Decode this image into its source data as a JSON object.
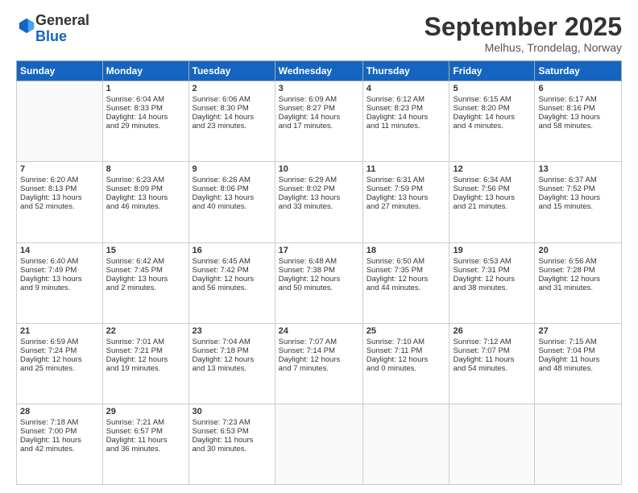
{
  "logo": {
    "general": "General",
    "blue": "Blue"
  },
  "title": "September 2025",
  "location": "Melhus, Trondelag, Norway",
  "days_header": [
    "Sunday",
    "Monday",
    "Tuesday",
    "Wednesday",
    "Thursday",
    "Friday",
    "Saturday"
  ],
  "weeks": [
    [
      {
        "day": "",
        "info": ""
      },
      {
        "day": "1",
        "info": "Sunrise: 6:04 AM\nSunset: 8:33 PM\nDaylight: 14 hours\nand 29 minutes."
      },
      {
        "day": "2",
        "info": "Sunrise: 6:06 AM\nSunset: 8:30 PM\nDaylight: 14 hours\nand 23 minutes."
      },
      {
        "day": "3",
        "info": "Sunrise: 6:09 AM\nSunset: 8:27 PM\nDaylight: 14 hours\nand 17 minutes."
      },
      {
        "day": "4",
        "info": "Sunrise: 6:12 AM\nSunset: 8:23 PM\nDaylight: 14 hours\nand 11 minutes."
      },
      {
        "day": "5",
        "info": "Sunrise: 6:15 AM\nSunset: 8:20 PM\nDaylight: 14 hours\nand 4 minutes."
      },
      {
        "day": "6",
        "info": "Sunrise: 6:17 AM\nSunset: 8:16 PM\nDaylight: 13 hours\nand 58 minutes."
      }
    ],
    [
      {
        "day": "7",
        "info": "Sunrise: 6:20 AM\nSunset: 8:13 PM\nDaylight: 13 hours\nand 52 minutes."
      },
      {
        "day": "8",
        "info": "Sunrise: 6:23 AM\nSunset: 8:09 PM\nDaylight: 13 hours\nand 46 minutes."
      },
      {
        "day": "9",
        "info": "Sunrise: 6:26 AM\nSunset: 8:06 PM\nDaylight: 13 hours\nand 40 minutes."
      },
      {
        "day": "10",
        "info": "Sunrise: 6:29 AM\nSunset: 8:02 PM\nDaylight: 13 hours\nand 33 minutes."
      },
      {
        "day": "11",
        "info": "Sunrise: 6:31 AM\nSunset: 7:59 PM\nDaylight: 13 hours\nand 27 minutes."
      },
      {
        "day": "12",
        "info": "Sunrise: 6:34 AM\nSunset: 7:56 PM\nDaylight: 13 hours\nand 21 minutes."
      },
      {
        "day": "13",
        "info": "Sunrise: 6:37 AM\nSunset: 7:52 PM\nDaylight: 13 hours\nand 15 minutes."
      }
    ],
    [
      {
        "day": "14",
        "info": "Sunrise: 6:40 AM\nSunset: 7:49 PM\nDaylight: 13 hours\nand 9 minutes."
      },
      {
        "day": "15",
        "info": "Sunrise: 6:42 AM\nSunset: 7:45 PM\nDaylight: 13 hours\nand 2 minutes."
      },
      {
        "day": "16",
        "info": "Sunrise: 6:45 AM\nSunset: 7:42 PM\nDaylight: 12 hours\nand 56 minutes."
      },
      {
        "day": "17",
        "info": "Sunrise: 6:48 AM\nSunset: 7:38 PM\nDaylight: 12 hours\nand 50 minutes."
      },
      {
        "day": "18",
        "info": "Sunrise: 6:50 AM\nSunset: 7:35 PM\nDaylight: 12 hours\nand 44 minutes."
      },
      {
        "day": "19",
        "info": "Sunrise: 6:53 AM\nSunset: 7:31 PM\nDaylight: 12 hours\nand 38 minutes."
      },
      {
        "day": "20",
        "info": "Sunrise: 6:56 AM\nSunset: 7:28 PM\nDaylight: 12 hours\nand 31 minutes."
      }
    ],
    [
      {
        "day": "21",
        "info": "Sunrise: 6:59 AM\nSunset: 7:24 PM\nDaylight: 12 hours\nand 25 minutes."
      },
      {
        "day": "22",
        "info": "Sunrise: 7:01 AM\nSunset: 7:21 PM\nDaylight: 12 hours\nand 19 minutes."
      },
      {
        "day": "23",
        "info": "Sunrise: 7:04 AM\nSunset: 7:18 PM\nDaylight: 12 hours\nand 13 minutes."
      },
      {
        "day": "24",
        "info": "Sunrise: 7:07 AM\nSunset: 7:14 PM\nDaylight: 12 hours\nand 7 minutes."
      },
      {
        "day": "25",
        "info": "Sunrise: 7:10 AM\nSunset: 7:11 PM\nDaylight: 12 hours\nand 0 minutes."
      },
      {
        "day": "26",
        "info": "Sunrise: 7:12 AM\nSunset: 7:07 PM\nDaylight: 11 hours\nand 54 minutes."
      },
      {
        "day": "27",
        "info": "Sunrise: 7:15 AM\nSunset: 7:04 PM\nDaylight: 11 hours\nand 48 minutes."
      }
    ],
    [
      {
        "day": "28",
        "info": "Sunrise: 7:18 AM\nSunset: 7:00 PM\nDaylight: 11 hours\nand 42 minutes."
      },
      {
        "day": "29",
        "info": "Sunrise: 7:21 AM\nSunset: 6:57 PM\nDaylight: 11 hours\nand 36 minutes."
      },
      {
        "day": "30",
        "info": "Sunrise: 7:23 AM\nSunset: 6:53 PM\nDaylight: 11 hours\nand 30 minutes."
      },
      {
        "day": "",
        "info": ""
      },
      {
        "day": "",
        "info": ""
      },
      {
        "day": "",
        "info": ""
      },
      {
        "day": "",
        "info": ""
      }
    ]
  ]
}
